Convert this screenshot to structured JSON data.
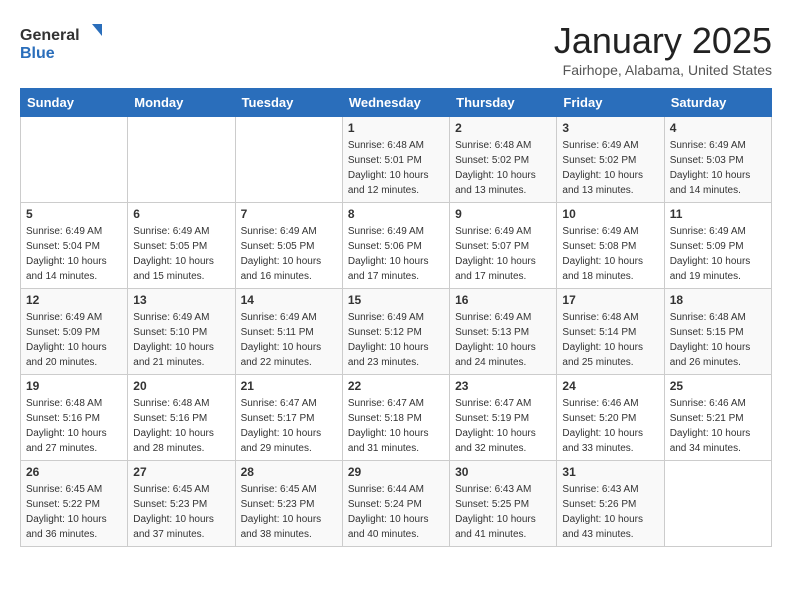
{
  "header": {
    "logo_general": "General",
    "logo_blue": "Blue",
    "month": "January 2025",
    "location": "Fairhope, Alabama, United States"
  },
  "weekdays": [
    "Sunday",
    "Monday",
    "Tuesday",
    "Wednesday",
    "Thursday",
    "Friday",
    "Saturday"
  ],
  "weeks": [
    [
      {
        "day": "",
        "info": ""
      },
      {
        "day": "",
        "info": ""
      },
      {
        "day": "",
        "info": ""
      },
      {
        "day": "1",
        "info": "Sunrise: 6:48 AM\nSunset: 5:01 PM\nDaylight: 10 hours\nand 12 minutes."
      },
      {
        "day": "2",
        "info": "Sunrise: 6:48 AM\nSunset: 5:02 PM\nDaylight: 10 hours\nand 13 minutes."
      },
      {
        "day": "3",
        "info": "Sunrise: 6:49 AM\nSunset: 5:02 PM\nDaylight: 10 hours\nand 13 minutes."
      },
      {
        "day": "4",
        "info": "Sunrise: 6:49 AM\nSunset: 5:03 PM\nDaylight: 10 hours\nand 14 minutes."
      }
    ],
    [
      {
        "day": "5",
        "info": "Sunrise: 6:49 AM\nSunset: 5:04 PM\nDaylight: 10 hours\nand 14 minutes."
      },
      {
        "day": "6",
        "info": "Sunrise: 6:49 AM\nSunset: 5:05 PM\nDaylight: 10 hours\nand 15 minutes."
      },
      {
        "day": "7",
        "info": "Sunrise: 6:49 AM\nSunset: 5:05 PM\nDaylight: 10 hours\nand 16 minutes."
      },
      {
        "day": "8",
        "info": "Sunrise: 6:49 AM\nSunset: 5:06 PM\nDaylight: 10 hours\nand 17 minutes."
      },
      {
        "day": "9",
        "info": "Sunrise: 6:49 AM\nSunset: 5:07 PM\nDaylight: 10 hours\nand 17 minutes."
      },
      {
        "day": "10",
        "info": "Sunrise: 6:49 AM\nSunset: 5:08 PM\nDaylight: 10 hours\nand 18 minutes."
      },
      {
        "day": "11",
        "info": "Sunrise: 6:49 AM\nSunset: 5:09 PM\nDaylight: 10 hours\nand 19 minutes."
      }
    ],
    [
      {
        "day": "12",
        "info": "Sunrise: 6:49 AM\nSunset: 5:09 PM\nDaylight: 10 hours\nand 20 minutes."
      },
      {
        "day": "13",
        "info": "Sunrise: 6:49 AM\nSunset: 5:10 PM\nDaylight: 10 hours\nand 21 minutes."
      },
      {
        "day": "14",
        "info": "Sunrise: 6:49 AM\nSunset: 5:11 PM\nDaylight: 10 hours\nand 22 minutes."
      },
      {
        "day": "15",
        "info": "Sunrise: 6:49 AM\nSunset: 5:12 PM\nDaylight: 10 hours\nand 23 minutes."
      },
      {
        "day": "16",
        "info": "Sunrise: 6:49 AM\nSunset: 5:13 PM\nDaylight: 10 hours\nand 24 minutes."
      },
      {
        "day": "17",
        "info": "Sunrise: 6:48 AM\nSunset: 5:14 PM\nDaylight: 10 hours\nand 25 minutes."
      },
      {
        "day": "18",
        "info": "Sunrise: 6:48 AM\nSunset: 5:15 PM\nDaylight: 10 hours\nand 26 minutes."
      }
    ],
    [
      {
        "day": "19",
        "info": "Sunrise: 6:48 AM\nSunset: 5:16 PM\nDaylight: 10 hours\nand 27 minutes."
      },
      {
        "day": "20",
        "info": "Sunrise: 6:48 AM\nSunset: 5:16 PM\nDaylight: 10 hours\nand 28 minutes."
      },
      {
        "day": "21",
        "info": "Sunrise: 6:47 AM\nSunset: 5:17 PM\nDaylight: 10 hours\nand 29 minutes."
      },
      {
        "day": "22",
        "info": "Sunrise: 6:47 AM\nSunset: 5:18 PM\nDaylight: 10 hours\nand 31 minutes."
      },
      {
        "day": "23",
        "info": "Sunrise: 6:47 AM\nSunset: 5:19 PM\nDaylight: 10 hours\nand 32 minutes."
      },
      {
        "day": "24",
        "info": "Sunrise: 6:46 AM\nSunset: 5:20 PM\nDaylight: 10 hours\nand 33 minutes."
      },
      {
        "day": "25",
        "info": "Sunrise: 6:46 AM\nSunset: 5:21 PM\nDaylight: 10 hours\nand 34 minutes."
      }
    ],
    [
      {
        "day": "26",
        "info": "Sunrise: 6:45 AM\nSunset: 5:22 PM\nDaylight: 10 hours\nand 36 minutes."
      },
      {
        "day": "27",
        "info": "Sunrise: 6:45 AM\nSunset: 5:23 PM\nDaylight: 10 hours\nand 37 minutes."
      },
      {
        "day": "28",
        "info": "Sunrise: 6:45 AM\nSunset: 5:23 PM\nDaylight: 10 hours\nand 38 minutes."
      },
      {
        "day": "29",
        "info": "Sunrise: 6:44 AM\nSunset: 5:24 PM\nDaylight: 10 hours\nand 40 minutes."
      },
      {
        "day": "30",
        "info": "Sunrise: 6:43 AM\nSunset: 5:25 PM\nDaylight: 10 hours\nand 41 minutes."
      },
      {
        "day": "31",
        "info": "Sunrise: 6:43 AM\nSunset: 5:26 PM\nDaylight: 10 hours\nand 43 minutes."
      },
      {
        "day": "",
        "info": ""
      }
    ]
  ]
}
